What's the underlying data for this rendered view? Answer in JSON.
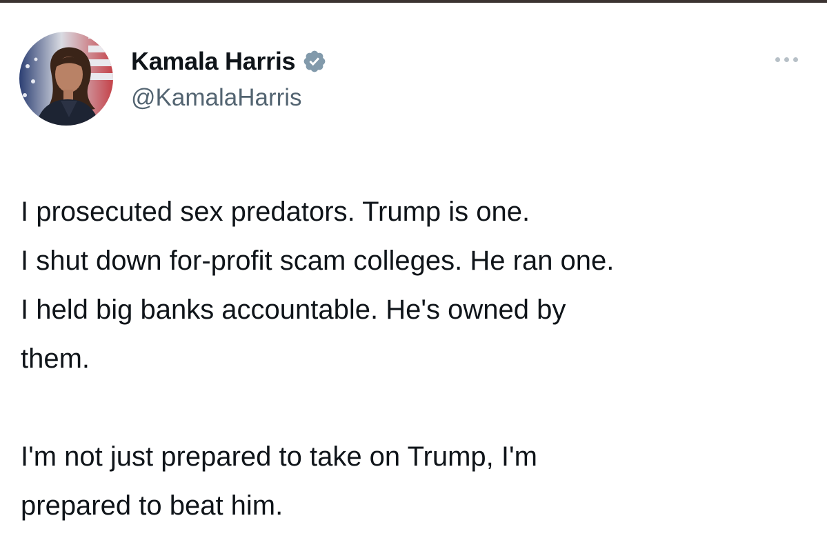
{
  "author": {
    "display_name": "Kamala Harris",
    "handle": "@KamalaHarris",
    "verified": true,
    "avatar_icon": "profile-photo"
  },
  "tweet": {
    "lines": [
      "I prosecuted sex predators. Trump is one.",
      "I shut down for-profit scam colleges. He ran one.",
      "I held big banks accountable. He's owned by",
      "them."
    ],
    "lines_2": [
      "I'm not just prepared to take on Trump, I'm",
      "prepared to beat him."
    ]
  },
  "icons": {
    "verified": "verified-badge-icon",
    "more": "more-options-icon"
  },
  "colors": {
    "text": "#0f1419",
    "secondary_text": "#536471",
    "verified_badge": "#829aab",
    "background": "#ffffff"
  }
}
